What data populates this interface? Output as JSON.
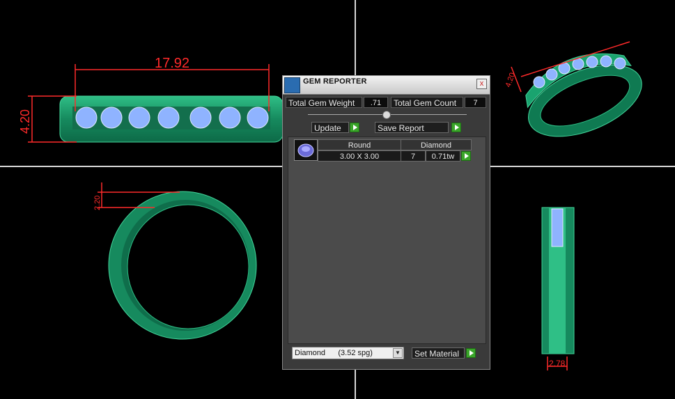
{
  "viewport": {
    "dimensions": {
      "top_width": "17.92",
      "top_height": "4.20",
      "perspective_height": "4.20",
      "front_thickness": "2.20",
      "side_width": "2.78"
    },
    "colors": {
      "ring": "#1f9a6a",
      "dimension": "#ff2a2a",
      "gem": "#8fb3ff",
      "axis": "#d8d8d8"
    }
  },
  "panel": {
    "title": "GEM REPORTER",
    "close_label": "x",
    "total_gem_weight_label": "Total Gem Weight",
    "total_gem_weight_value": ".71",
    "total_gem_count_label": "Total Gem Count",
    "total_gem_count_value": "7",
    "update_label": "Update",
    "save_report_label": "Save Report",
    "table": {
      "headers": [
        "Round",
        "Diamond"
      ],
      "row": {
        "size": "3.00 X 3.00",
        "count": "7",
        "weight": "0.71tw"
      }
    },
    "material_select": {
      "value": "Diamond      (3.52 spg)"
    },
    "set_material_label": "Set Material"
  }
}
